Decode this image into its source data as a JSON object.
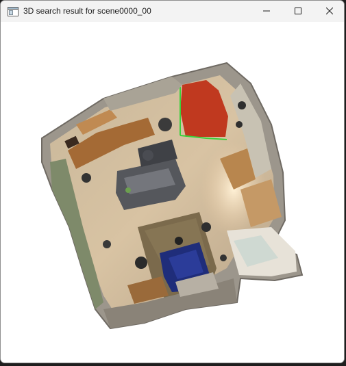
{
  "window": {
    "title": "3D search result for scene0000_00"
  },
  "icons": {
    "app": "app-window-icon",
    "minimize": "minimize-icon",
    "maximize": "maximize-icon",
    "close": "close-icon"
  },
  "colors": {
    "highlight_object": "#c0391f",
    "highlight_box": "#3cd13c",
    "background": "#ffffff"
  }
}
